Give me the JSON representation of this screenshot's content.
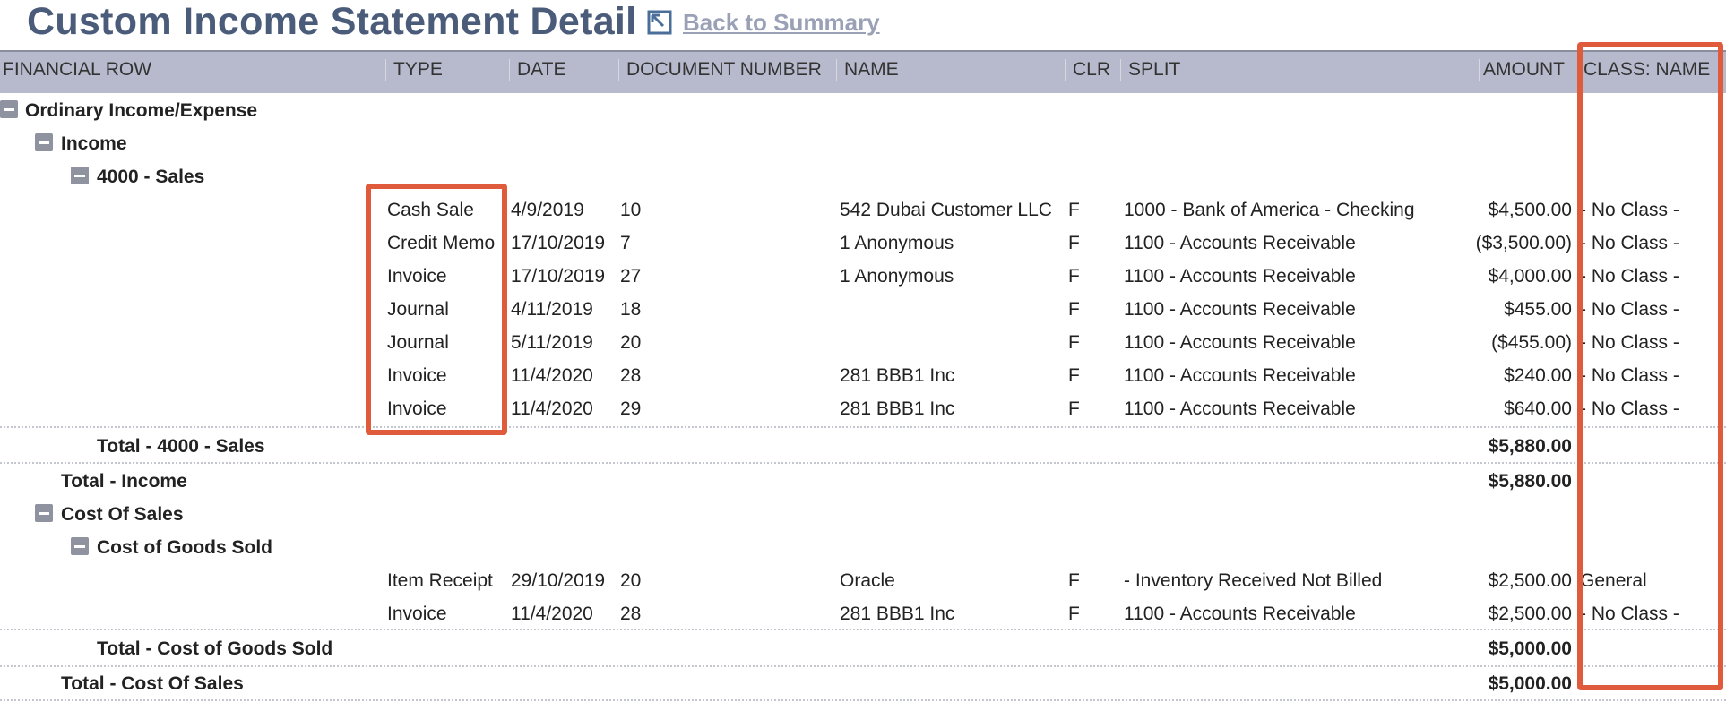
{
  "page": {
    "title": "Custom Income Statement Detail",
    "back_link": "Back to Summary"
  },
  "columns": {
    "financial_row": "FINANCIAL ROW",
    "type": "TYPE",
    "date": "DATE",
    "doc": "DOCUMENT NUMBER",
    "name": "NAME",
    "clr": "CLR",
    "split": "SPLIT",
    "amount": "AMOUNT",
    "class": "CLASS: NAME"
  },
  "sections": {
    "ordinary": "Ordinary Income/Expense",
    "income": "Income",
    "sales": "4000 - Sales",
    "total_sales": "Total - 4000 - Sales",
    "total_sales_amount": "$5,880.00",
    "total_income": "Total - Income",
    "total_income_amount": "$5,880.00",
    "cost_of_sales": "Cost Of Sales",
    "cogs": "Cost of Goods Sold",
    "total_cogs": "Total - Cost of Goods Sold",
    "total_cogs_amount": "$5,000.00",
    "total_cost_of_sales": "Total - Cost Of Sales",
    "total_cost_of_sales_amount": "$5,000.00"
  },
  "sales_rows": [
    {
      "type": "Cash Sale",
      "date": "4/9/2019",
      "doc": "10",
      "name": "542 Dubai Customer LLC",
      "clr": "F",
      "split": "1000 - Bank of America - Checking",
      "amount": "$4,500.00",
      "class": "- No Class -"
    },
    {
      "type": "Credit Memo",
      "date": "17/10/2019",
      "doc": "7",
      "name": "1 Anonymous",
      "clr": "F",
      "split": "1100 - Accounts Receivable",
      "amount": "($3,500.00)",
      "class": "- No Class -"
    },
    {
      "type": "Invoice",
      "date": "17/10/2019",
      "doc": "27",
      "name": "1 Anonymous",
      "clr": "F",
      "split": "1100 - Accounts Receivable",
      "amount": "$4,000.00",
      "class": "- No Class -"
    },
    {
      "type": "Journal",
      "date": "4/11/2019",
      "doc": "18",
      "name": "",
      "clr": "F",
      "split": "1100 - Accounts Receivable",
      "amount": "$455.00",
      "class": "- No Class -"
    },
    {
      "type": "Journal",
      "date": "5/11/2019",
      "doc": "20",
      "name": "",
      "clr": "F",
      "split": "1100 - Accounts Receivable",
      "amount": "($455.00)",
      "class": "- No Class -"
    },
    {
      "type": "Invoice",
      "date": "11/4/2020",
      "doc": "28",
      "name": "281 BBB1 Inc",
      "clr": "F",
      "split": "1100 - Accounts Receivable",
      "amount": "$240.00",
      "class": "- No Class -"
    },
    {
      "type": "Invoice",
      "date": "11/4/2020",
      "doc": "29",
      "name": "281 BBB1 Inc",
      "clr": "F",
      "split": "1100 - Accounts Receivable",
      "amount": "$640.00",
      "class": "- No Class -"
    }
  ],
  "cogs_rows": [
    {
      "type": "Item Receipt",
      "date": "29/10/2019",
      "doc": "20",
      "name": "Oracle",
      "clr": "F",
      "split": "- Inventory Received Not Billed",
      "amount": "$2,500.00",
      "class": "General"
    },
    {
      "type": "Invoice",
      "date": "11/4/2020",
      "doc": "28",
      "name": "281 BBB1 Inc",
      "clr": "F",
      "split": "1100 - Accounts Receivable",
      "amount": "$2,500.00",
      "class": "- No Class -"
    }
  ],
  "colors": {
    "title": "#4a5c7a",
    "header_bg": "#b7b9cc",
    "highlight": "#e05a3c"
  }
}
